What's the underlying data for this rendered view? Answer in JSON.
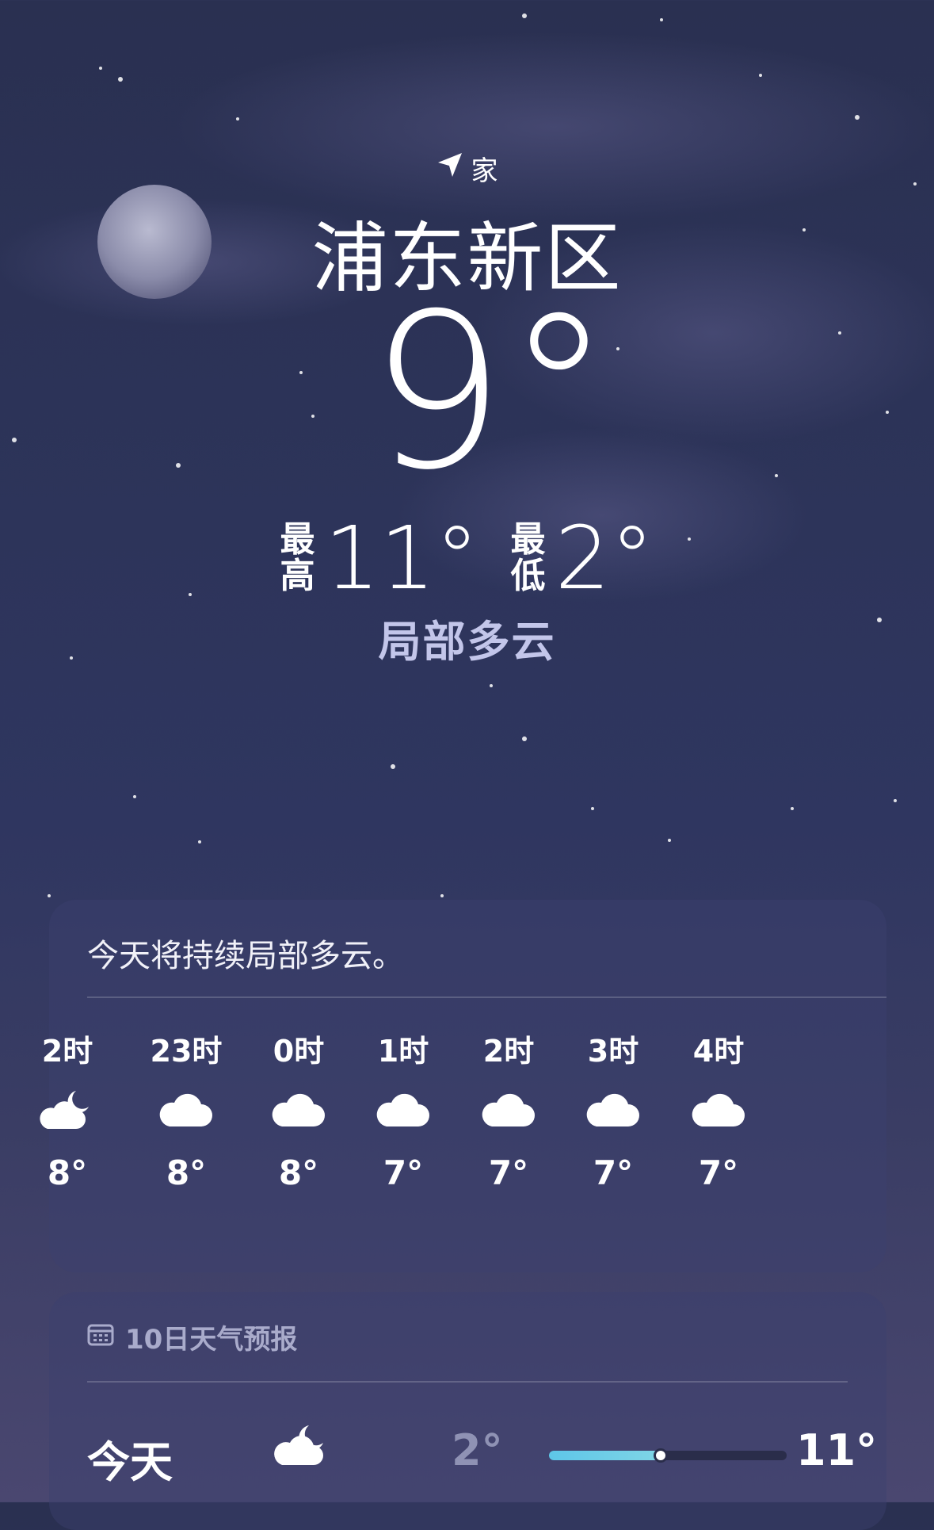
{
  "location": {
    "home_label": "家",
    "city": "浦东新区"
  },
  "current": {
    "temperature": "9°",
    "high_label": "最高",
    "high_value": "11°",
    "low_label": "最低",
    "low_value": "2°",
    "condition": "局部多云"
  },
  "hourly": {
    "summary": "今天将持续局部多云。",
    "items": [
      {
        "time": "2时",
        "icon": "cloud-moon-icon",
        "temp": "8°"
      },
      {
        "time": "23时",
        "icon": "cloud-icon",
        "temp": "8°"
      },
      {
        "time": "0时",
        "icon": "cloud-icon",
        "temp": "8°"
      },
      {
        "time": "1时",
        "icon": "cloud-icon",
        "temp": "7°"
      },
      {
        "time": "2时",
        "icon": "cloud-icon",
        "temp": "7°"
      },
      {
        "time": "3时",
        "icon": "cloud-icon",
        "temp": "7°"
      },
      {
        "time": "4时",
        "icon": "cloud-icon",
        "temp": "7°"
      }
    ]
  },
  "forecast": {
    "title": "10日天气预报",
    "days": [
      {
        "day": "今天",
        "icon": "cloud-moon-icon",
        "low": "2°",
        "high": "11°",
        "range_start": 0.0,
        "range_end": 0.47,
        "current_pos": 0.47
      }
    ]
  },
  "colors": {
    "bar_fill": "#5ec6e8",
    "condition_text": "#c3c6ea",
    "muted": "#8f92b4"
  }
}
